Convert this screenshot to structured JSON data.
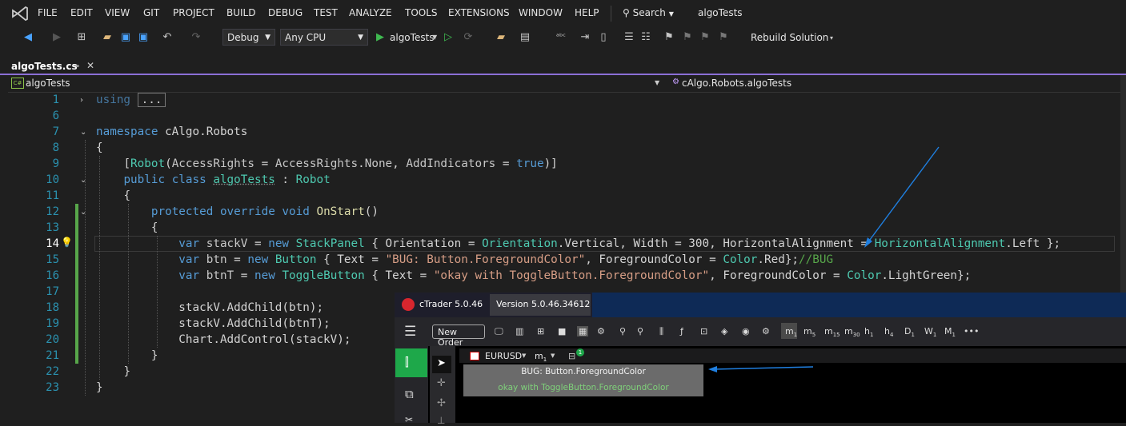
{
  "menu": {
    "items": [
      "FILE",
      "EDIT",
      "VIEW",
      "GIT",
      "PROJECT",
      "BUILD",
      "DEBUG",
      "TEST",
      "ANALYZE",
      "TOOLS",
      "EXTENSIONS",
      "WINDOW",
      "HELP"
    ],
    "search_label": "Search",
    "solution_name": "algoTests"
  },
  "toolbar": {
    "config": "Debug",
    "platform": "Any CPU",
    "run_target": "algoTests",
    "rebuild": "Rebuild Solution"
  },
  "tab": {
    "title": "algoTests.cs",
    "pin": "⊸",
    "close": "✕"
  },
  "nav": {
    "left": "algoTests",
    "right": "cAlgo.Robots.algoTests"
  },
  "editor": {
    "line_numbers": [
      "1",
      "6",
      "7",
      "8",
      "9",
      "10",
      "11",
      "12",
      "13",
      "14",
      "15",
      "16",
      "17",
      "18",
      "19",
      "20",
      "21",
      "22",
      "23"
    ],
    "using_collapsed": "...",
    "lines": {
      "l1_kw": "using",
      "l7_kw": "namespace",
      "l7_ns": "cAlgo.Robots",
      "l8": "{",
      "l9_attr_open": "[",
      "l9_attr": "Robot",
      "l9_rest1": "(",
      "l9_prop1": "AccessRights",
      "l9_eq1": " = ",
      "l9_val1": "AccessRights",
      "l9_dot": ".",
      "l9_val1b": "None",
      "l9_comma": ", ",
      "l9_prop2": "AddIndicators",
      "l9_eq2": " = ",
      "l9_true": "true",
      "l9_close": ")]",
      "l10_kw": "public class",
      "l10_name": "algoTests",
      "l10_colon": " : ",
      "l10_base": "Robot",
      "l11": "{",
      "l12_kw": "protected override void",
      "l12_fn": "OnStart",
      "l12_paren": "()",
      "l13": "{",
      "l14_var": "var",
      "l14_name": "stackV",
      "l14_eq": " = ",
      "l14_new": "new",
      "l14_type": "StackPanel",
      "l14_rest": " { Orientation = ",
      "l14_t2": "Orientation",
      "l14_rest2": ".Vertical, Width = 300, HorizontalAlignment = ",
      "l14_t3": "HorizontalAlignment",
      "l14_rest3": ".Left };",
      "l15_var": "var",
      "l15_name": "btn",
      "l15_eq": " = ",
      "l15_new": "new",
      "l15_type": "Button",
      "l15_rest": " { Text = ",
      "l15_str": "\"BUG: Button.ForegroundColor\"",
      "l15_rest2": ", ForegroundColor = ",
      "l15_t2": "Color",
      "l15_rest3": ".Red};",
      "l15_comment": "//BUG",
      "l16_var": "var",
      "l16_name": "btnT",
      "l16_eq": " = ",
      "l16_new": "new",
      "l16_type": "ToggleButton",
      "l16_rest": " { Text = ",
      "l16_str": "\"okay with ToggleButton.ForegroundColor\"",
      "l16_rest2": ", ForegroundColor = ",
      "l16_t2": "Color",
      "l16_rest3": ".LightGreen};",
      "l18": "stackV.AddChild(btn);",
      "l19": "stackV.AddChild(btnT);",
      "l20": "Chart.AddControl(stackV);",
      "l21": "}",
      "l22": "}",
      "l23": "}"
    }
  },
  "ctrader": {
    "app_title": "cTrader 5.0.46",
    "version": "Version 5.0.46.34612",
    "new_order": "New Order",
    "symbol": "EURUSD",
    "timeframe": "m",
    "timeframe_sub": "1",
    "badge": "1",
    "timeframes": [
      "m",
      "m",
      "m",
      "m",
      "h",
      "h",
      "D",
      "W",
      "M"
    ],
    "timeframe_subs": [
      "1",
      "5",
      "15",
      "30",
      "1",
      "4",
      "1",
      "1",
      "1"
    ],
    "bug_button": "BUG: Button.ForegroundColor",
    "toggle_button": "okay with ToggleButton.ForegroundColor",
    "more": "•••"
  },
  "colors": {
    "accent_purple": "#8b6fd6",
    "annotation_arrow": "#1f7fe0",
    "ctrader_green": "#1ea84a",
    "toggle_text": "#7fd17a"
  }
}
